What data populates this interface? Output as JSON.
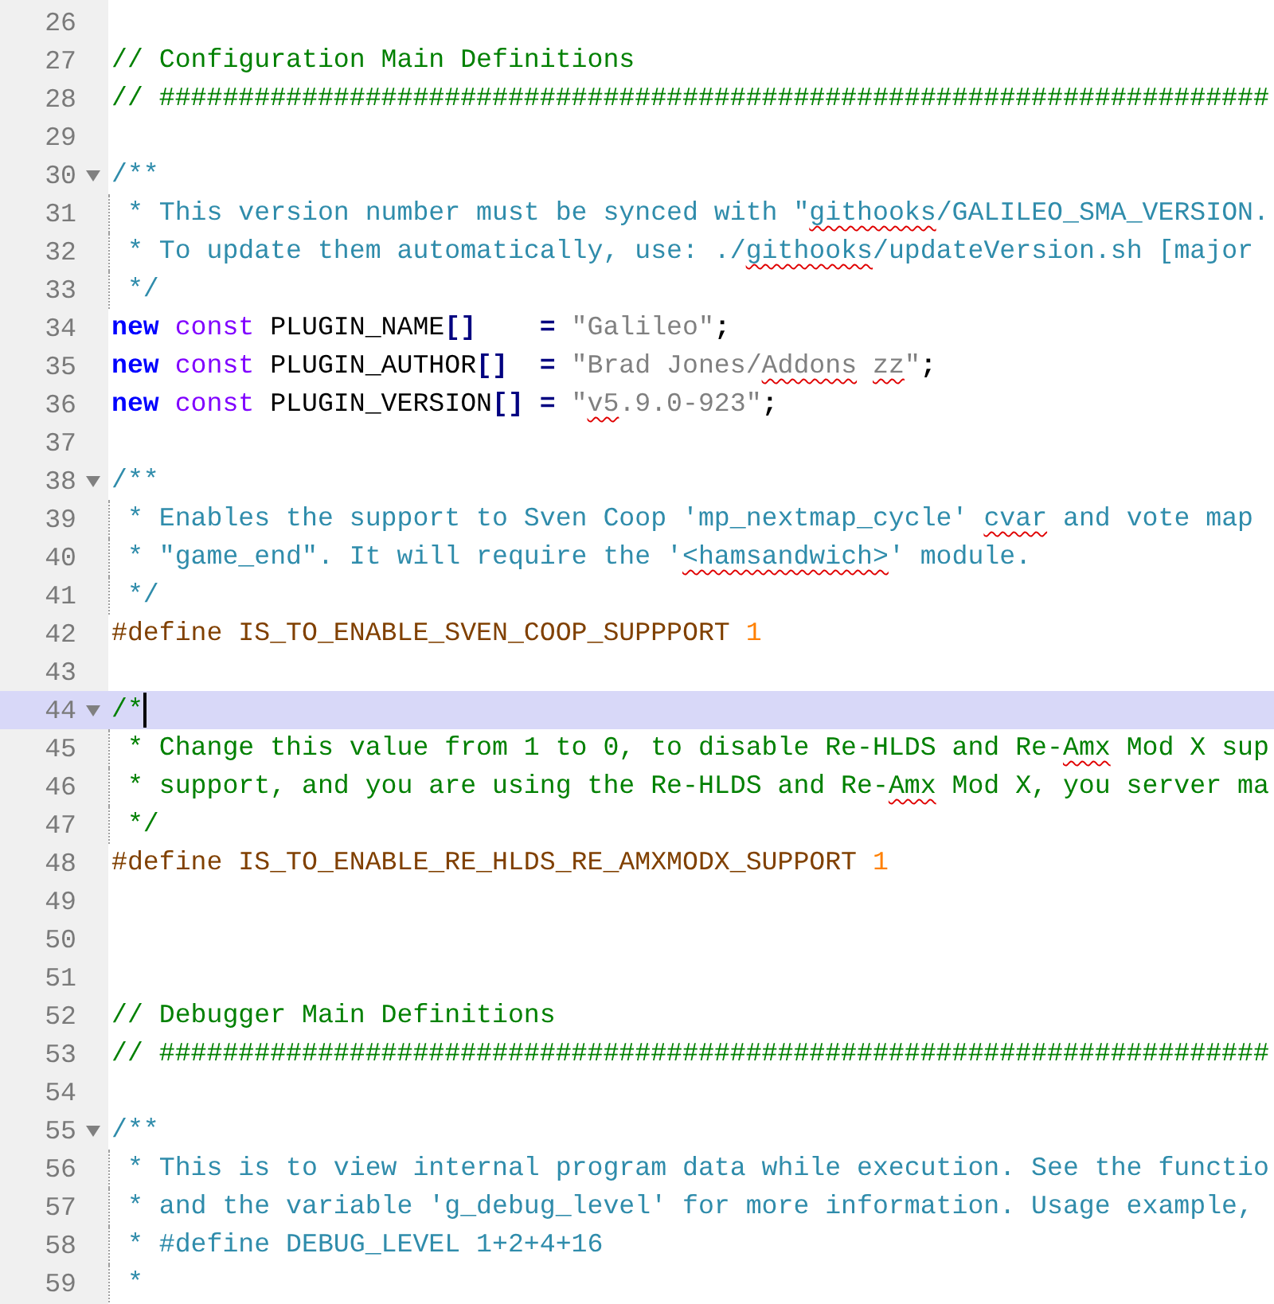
{
  "editor": {
    "lines": [
      {
        "number": "26"
      },
      {
        "number": "27",
        "tokens": [
          {
            "kind": "comment",
            "text": "// Configuration Main Definitions"
          }
        ]
      },
      {
        "number": "28",
        "tokens": [
          {
            "kind": "comment",
            "text": "// ######################################################################"
          }
        ]
      },
      {
        "number": "29"
      },
      {
        "number": "30",
        "fold_marker": true,
        "tokens": [
          {
            "kind": "doc",
            "text": "/**"
          }
        ]
      },
      {
        "number": "31",
        "fold_guide": true,
        "tokens": [
          {
            "kind": "doc",
            "text": " * This version number must be synced with \""
          },
          {
            "kind": "doc",
            "text": "githooks",
            "misspelled": true
          },
          {
            "kind": "doc",
            "text": "/GALILEO_SMA_VERSION."
          }
        ]
      },
      {
        "number": "32",
        "fold_guide": true,
        "tokens": [
          {
            "kind": "doc",
            "text": " * To update them automatically, use: ./"
          },
          {
            "kind": "doc",
            "text": "githooks",
            "misspelled": true
          },
          {
            "kind": "doc",
            "text": "/updateVersion.sh [major"
          }
        ]
      },
      {
        "number": "33",
        "fold_guide": true,
        "tokens": [
          {
            "kind": "doc",
            "text": " */"
          }
        ]
      },
      {
        "number": "34",
        "tokens": [
          {
            "kind": "keyword",
            "text": "new"
          },
          {
            "kind": "type",
            "text": " const"
          },
          {
            "kind": "plain",
            "text": " PLUGIN_NAME"
          },
          {
            "kind": "op",
            "text": "[]"
          },
          {
            "kind": "op",
            "text": "    ="
          },
          {
            "kind": "string",
            "text": " \"Galileo\""
          },
          {
            "kind": "punct",
            "text": ";"
          }
        ]
      },
      {
        "number": "35",
        "tokens": [
          {
            "kind": "keyword",
            "text": "new"
          },
          {
            "kind": "type",
            "text": " const"
          },
          {
            "kind": "plain",
            "text": " PLUGIN_AUTHOR"
          },
          {
            "kind": "op",
            "text": "[]"
          },
          {
            "kind": "op",
            "text": "  ="
          },
          {
            "kind": "string",
            "text": " \"Brad Jones/"
          },
          {
            "kind": "string",
            "text": "Addons",
            "misspelled": true
          },
          {
            "kind": "string",
            "text": " zz",
            "misspelled": true
          },
          {
            "kind": "string",
            "text": "\""
          },
          {
            "kind": "punct",
            "text": ";"
          }
        ]
      },
      {
        "number": "36",
        "tokens": [
          {
            "kind": "keyword",
            "text": "new"
          },
          {
            "kind": "type",
            "text": " const"
          },
          {
            "kind": "plain",
            "text": " PLUGIN_VERSION"
          },
          {
            "kind": "op",
            "text": "[]"
          },
          {
            "kind": "op",
            "text": " ="
          },
          {
            "kind": "string",
            "text": " \""
          },
          {
            "kind": "string",
            "text": "v5",
            "misspelled": true
          },
          {
            "kind": "string",
            "text": ".9.0-923\""
          },
          {
            "kind": "punct",
            "text": ";"
          }
        ]
      },
      {
        "number": "37"
      },
      {
        "number": "38",
        "fold_marker": true,
        "tokens": [
          {
            "kind": "doc",
            "text": "/**"
          }
        ]
      },
      {
        "number": "39",
        "fold_guide": true,
        "tokens": [
          {
            "kind": "doc",
            "text": " * Enables the support to Sven Coop 'mp_nextmap_cycle'"
          },
          {
            "kind": "doc",
            "text": " cvar",
            "misspelled": true
          },
          {
            "kind": "doc",
            "text": " and vote map"
          }
        ]
      },
      {
        "number": "40",
        "fold_guide": true,
        "tokens": [
          {
            "kind": "doc",
            "text": " * \"game_end\". It will require the '"
          },
          {
            "kind": "doc",
            "text": "<hamsandwich>",
            "misspelled": true
          },
          {
            "kind": "doc",
            "text": "' module."
          }
        ]
      },
      {
        "number": "41",
        "fold_guide": true,
        "tokens": [
          {
            "kind": "doc",
            "text": " */"
          }
        ]
      },
      {
        "number": "42",
        "tokens": [
          {
            "kind": "preproc",
            "text": "#define IS_TO_ENABLE_SVEN_COOP_SUPPPORT"
          },
          {
            "kind": "number",
            "text": " 1"
          }
        ]
      },
      {
        "number": "43"
      },
      {
        "number": "44",
        "fold_marker": true,
        "current": true,
        "tokens": [
          {
            "kind": "comment",
            "text": "/*"
          }
        ]
      },
      {
        "number": "45",
        "fold_guide": true,
        "tokens": [
          {
            "kind": "comment",
            "text": " * Change this value from 1 to 0, to disable Re-HLDS and Re-"
          },
          {
            "kind": "comment",
            "text": "Amx",
            "misspelled": true
          },
          {
            "kind": "comment",
            "text": " Mod X sup"
          }
        ]
      },
      {
        "number": "46",
        "fold_guide": true,
        "tokens": [
          {
            "kind": "comment",
            "text": " * support, and you are using the Re-HLDS and Re-"
          },
          {
            "kind": "comment",
            "text": "Amx",
            "misspelled": true
          },
          {
            "kind": "comment",
            "text": " Mod X, you server ma"
          }
        ]
      },
      {
        "number": "47",
        "fold_guide": true,
        "tokens": [
          {
            "kind": "comment",
            "text": " */"
          }
        ]
      },
      {
        "number": "48",
        "tokens": [
          {
            "kind": "preproc",
            "text": "#define IS_TO_ENABLE_RE_HLDS_RE_AMXMODX_SUPPORT"
          },
          {
            "kind": "number",
            "text": " 1"
          }
        ]
      },
      {
        "number": "49"
      },
      {
        "number": "50"
      },
      {
        "number": "51"
      },
      {
        "number": "52",
        "tokens": [
          {
            "kind": "comment",
            "text": "// Debugger Main Definitions"
          }
        ]
      },
      {
        "number": "53",
        "tokens": [
          {
            "kind": "comment",
            "text": "// ######################################################################"
          }
        ]
      },
      {
        "number": "54"
      },
      {
        "number": "55",
        "fold_marker": true,
        "tokens": [
          {
            "kind": "doc",
            "text": "/**"
          }
        ]
      },
      {
        "number": "56",
        "fold_guide": true,
        "tokens": [
          {
            "kind": "doc",
            "text": " * This is to view internal program data while execution. See the functio"
          }
        ]
      },
      {
        "number": "57",
        "fold_guide": true,
        "tokens": [
          {
            "kind": "doc",
            "text": " * and the variable 'g_debug_level' for more information. Usage example,"
          }
        ]
      },
      {
        "number": "58",
        "fold_guide": true,
        "tokens": [
          {
            "kind": "doc",
            "text": " * #define DEBUG_LEVEL 1+2+4+16"
          }
        ]
      },
      {
        "number": "59",
        "fold_guide": true,
        "tokens": [
          {
            "kind": "doc",
            "text": " *"
          }
        ]
      }
    ]
  }
}
